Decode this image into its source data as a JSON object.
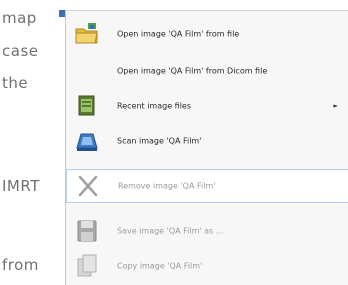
{
  "background_text": [
    "map",
    "case",
    "the",
    "IMRT",
    "from"
  ],
  "menu": {
    "items": [
      {
        "label": "Open image 'QA Film' from file",
        "icon": "open-folder-icon",
        "enabled": true
      },
      {
        "label": "Open image 'QA Film' from Dicom file",
        "icon": "",
        "enabled": true
      },
      {
        "label": "Recent image files",
        "icon": "recent-files-icon",
        "enabled": true,
        "submenu_arrow": "►"
      },
      {
        "label": "Scan image 'QA Film'",
        "icon": "scanner-icon",
        "enabled": true
      },
      {
        "label": "Remove image 'QA Film'",
        "icon": "remove-x-icon",
        "enabled": false
      },
      {
        "label": "Save image 'QA Film' as ...",
        "icon": "save-disk-icon",
        "enabled": false
      },
      {
        "label": "Copy image 'QA Film'",
        "icon": "copy-icon",
        "enabled": false
      }
    ]
  },
  "colors": {
    "accent": "#3b6fb5",
    "disabled_text": "#9a9a9a",
    "highlight_border": "#b7cfe6"
  }
}
